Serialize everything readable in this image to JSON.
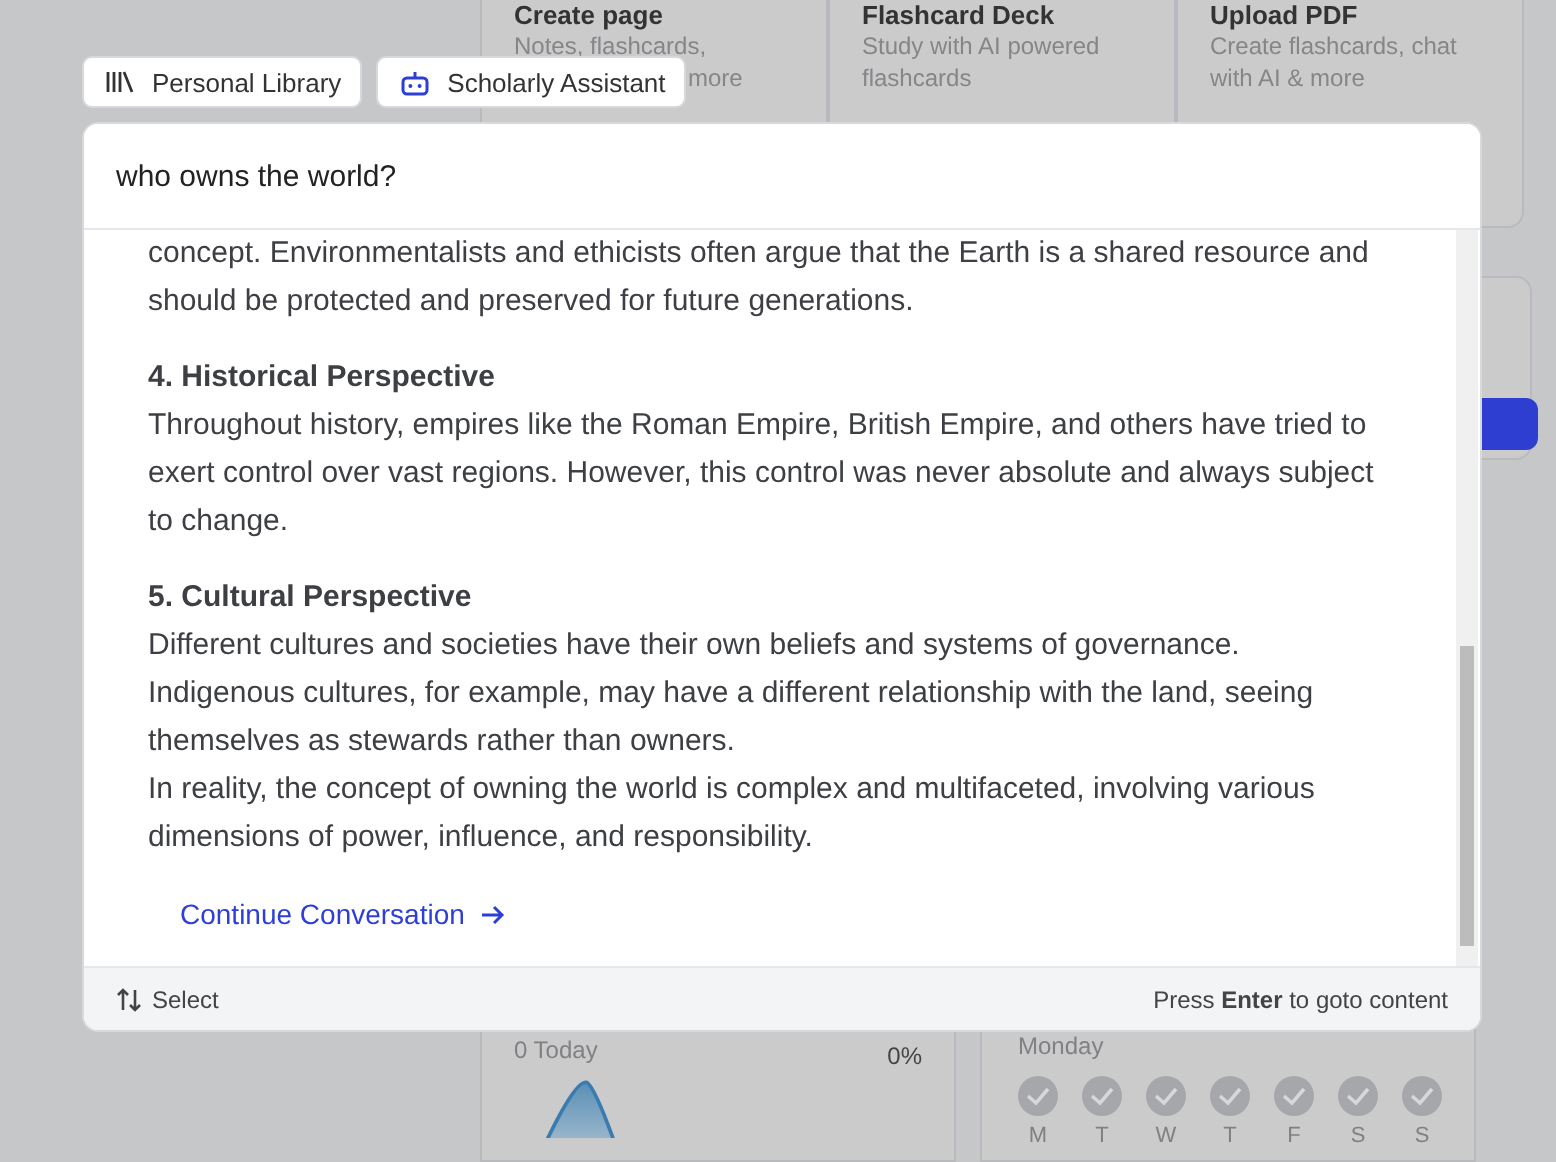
{
  "background": {
    "action_cards": [
      {
        "title": "Create page",
        "subtitle_lines": [
          "Notes, flashcards,",
          "more"
        ]
      },
      {
        "title": "Flashcard Deck",
        "subtitle_lines": [
          "Study with AI powered",
          "flashcards"
        ]
      },
      {
        "title": "Upload PDF",
        "subtitle_lines": [
          "Create flashcards, chat",
          "with AI & more"
        ]
      }
    ],
    "progress_card": {
      "count": "0 Today",
      "percent": "0%"
    },
    "week_card": {
      "day": "Monday",
      "days": [
        {
          "label": "M",
          "done": false
        },
        {
          "label": "T",
          "done": false
        },
        {
          "label": "W",
          "done": false
        },
        {
          "label": "T",
          "done": false
        },
        {
          "label": "F",
          "done": false
        },
        {
          "label": "S",
          "done": false
        },
        {
          "label": "S",
          "done": false
        }
      ]
    }
  },
  "chips": [
    {
      "kind": "library",
      "label": "Personal Library"
    },
    {
      "kind": "assistant",
      "label": "Scholarly Assistant"
    }
  ],
  "search": {
    "value": "who owns the world?"
  },
  "answer": [
    {
      "kind": "paragraph",
      "text": "concept. Environmentalists and ethicists often argue that the Earth is a shared resource and should be protected and preserved for future generations."
    },
    {
      "kind": "heading",
      "text": "4. Historical Perspective"
    },
    {
      "kind": "paragraph",
      "text": "Throughout history, empires like the Roman Empire, British Empire, and others have tried to exert control over vast regions. However, this control was never absolute and always subject to change."
    },
    {
      "kind": "heading",
      "text": "5. Cultural Perspective"
    },
    {
      "kind": "paragraph",
      "text": "Different cultures and societies have their own beliefs and systems of governance. Indigenous cultures, for example, may have a different relationship with the land, seeing themselves as stewards rather than owners."
    },
    {
      "kind": "paragraph",
      "text": "In reality, the concept of owning the world is complex and multifaceted, involving various dimensions of power, influence, and responsibility."
    }
  ],
  "continue_link": "Continue Conversation",
  "footer": {
    "hint_left": "Select",
    "hint_right": "Press **Enter** to goto content"
  }
}
